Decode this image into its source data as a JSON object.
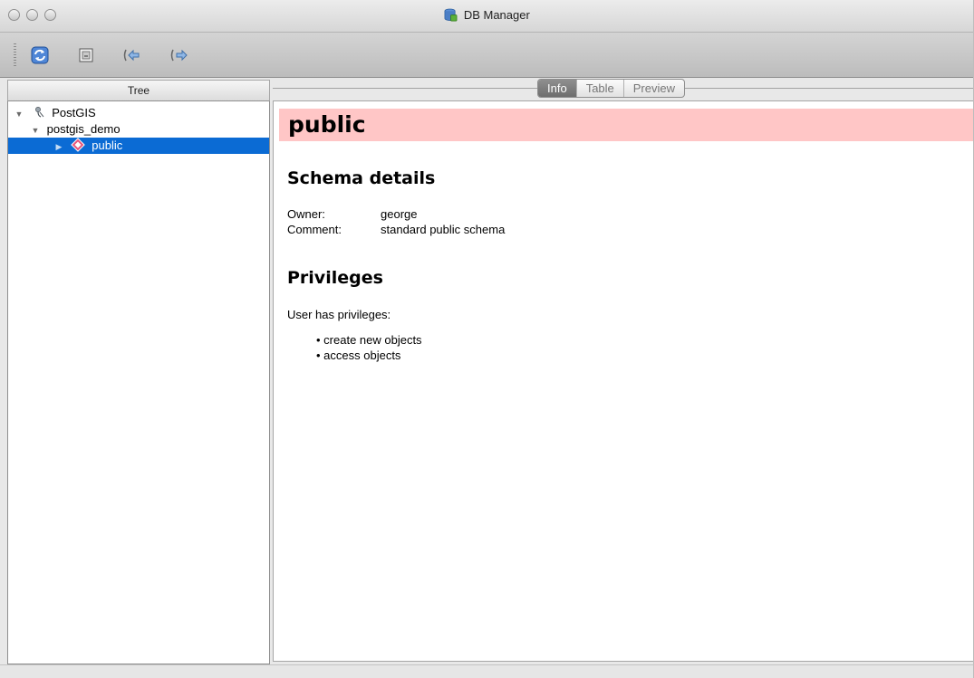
{
  "window": {
    "title": "DB Manager",
    "title_icon": "db-manager-icon"
  },
  "toolbar": {
    "buttons": [
      {
        "name": "refresh",
        "icon": "refresh-icon"
      },
      {
        "name": "sql-window",
        "icon": "sql-window-icon"
      },
      {
        "name": "import-layer",
        "icon": "import-icon"
      },
      {
        "name": "export-file",
        "icon": "export-icon"
      }
    ]
  },
  "tree": {
    "header": "Tree",
    "items": [
      {
        "label": "PostGIS",
        "icon": "postgis-elephant-icon",
        "expanded": true,
        "depth": 0
      },
      {
        "label": "postgis_demo",
        "expanded": true,
        "depth": 1
      },
      {
        "label": "public",
        "icon": "schema-icon",
        "expanded": false,
        "depth": 2,
        "selected": true
      }
    ]
  },
  "tabs": [
    {
      "label": "Info",
      "active": true
    },
    {
      "label": "Table",
      "active": false
    },
    {
      "label": "Preview",
      "active": false
    }
  ],
  "info": {
    "title": "public",
    "banner_color": "#ffc6c6",
    "schema_details": {
      "heading": "Schema details",
      "owner_label": "Owner:",
      "owner_value": "george",
      "comment_label": "Comment:",
      "comment_value": "standard public schema"
    },
    "privileges": {
      "heading": "Privileges",
      "intro": "User has privileges:",
      "items": [
        "• create new objects",
        "• access objects"
      ]
    }
  },
  "colors": {
    "selection": "#0b6bd4",
    "banner": "#ffc6c6"
  }
}
